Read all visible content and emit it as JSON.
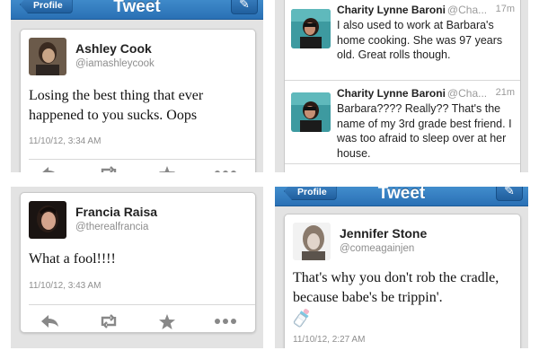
{
  "nav": {
    "back_label": "Profile",
    "title": "Tweet"
  },
  "colors": {
    "nav_blue": "#3a84c9",
    "handle_gray": "#8e8e8e"
  },
  "icons": [
    "reply-icon",
    "retweet-icon",
    "favorite-icon",
    "more-icon",
    "compose-icon",
    "baby-bottle-emoji"
  ],
  "tweet_ashley": {
    "name": "Ashley Cook",
    "handle": "@iamashleycook",
    "text": "Losing the best thing that ever happened to you sucks. Oops",
    "timestamp": "11/10/12, 3:34 AM"
  },
  "timeline": [
    {
      "name": "Charity Lynne Baroni",
      "handle": "@Cha...",
      "time": "17m",
      "text": "I also used to work at Barbara's home cooking. She was 97 years old. Great rolls though."
    },
    {
      "name": "Charity Lynne Baroni",
      "handle": "@Cha...",
      "time": "21m",
      "text": "Barbara???? Really?? That's the name of my 3rd grade best friend. I was too afraid to sleep over at her house."
    }
  ],
  "tweet_francia": {
    "name": "Francia Raisa",
    "handle": "@therealfrancia",
    "text": "What a fool!!!!",
    "timestamp": "11/10/12, 3:43 AM"
  },
  "tweet_jennifer": {
    "name": "Jennifer Stone",
    "handle": "@comeagainjen",
    "text": "That's why you don't rob the cradle, because babe's be trippin'.",
    "timestamp": "11/10/12, 2:27 AM"
  }
}
